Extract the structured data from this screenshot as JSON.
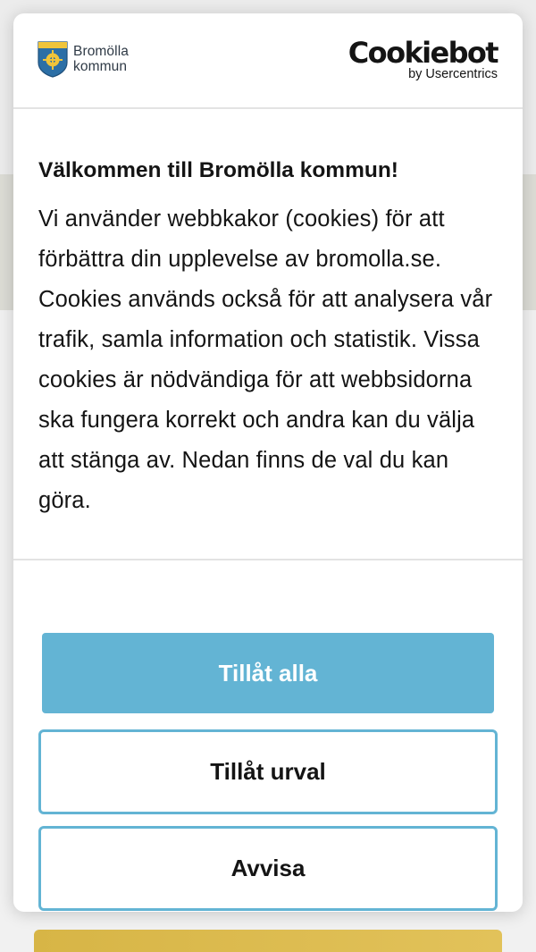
{
  "brand": {
    "line1": "Bromölla",
    "line2": "kommun",
    "crest_icon": "bromolla-crest-icon"
  },
  "cookiebot": {
    "wordmark": "Cookiebot",
    "tagline": "by Usercentrics"
  },
  "consent": {
    "title": "Välkommen till Bromölla kommun!",
    "body": "Vi använder webbkakor (cookies) för att förbättra din upplevelse av bromolla.se. Cookies används också för att analysera vår trafik, samla information och statistik. Vissa cookies är nödvändiga för att webbsidorna ska fungera korrekt och andra kan du välja att stänga av. Nedan finns de val du kan göra."
  },
  "buttons": {
    "allow_all": "Tillåt alla",
    "allow_selection": "Tillåt urval",
    "deny": "Avvisa"
  },
  "colors": {
    "accent": "#63b4d4",
    "text": "#141414",
    "page_bg": "#efefef",
    "beige_band": "#dcdcd5",
    "gold_bar": "#d7b546"
  }
}
